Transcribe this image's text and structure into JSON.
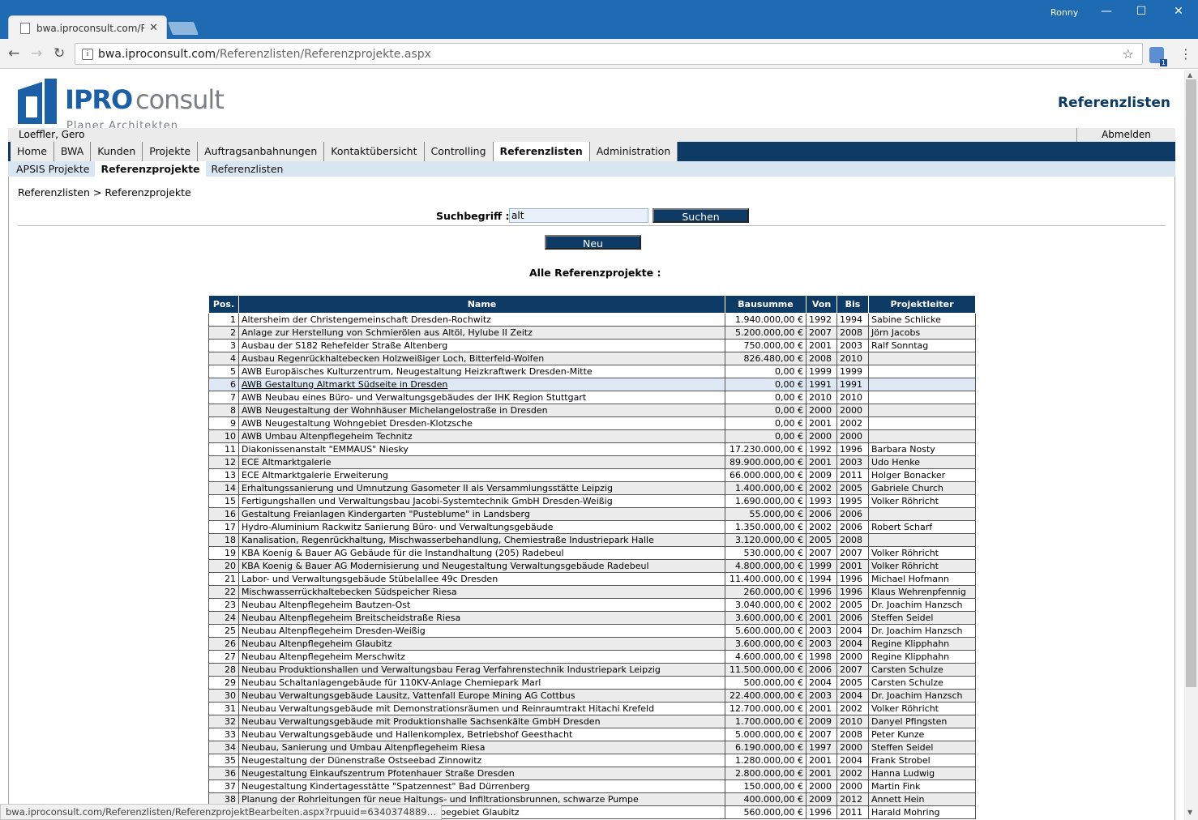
{
  "browser": {
    "tab_title": "bwa.iproconsult.com/Ref",
    "url_host": "bwa.iproconsult.com",
    "url_path": "/Referenzlisten/Referenzprojekte.aspx",
    "user": "Ronny",
    "extension_badge": "1",
    "status_url": "bwa.iproconsult.com/Referenzlisten/ReferenzprojektBearbeiten.aspx?rpuuid=6340374889…"
  },
  "header": {
    "logo_bold": "IPRO",
    "logo_light": "consult",
    "logo_tagline": "Planer  Architekten  Ingenieure",
    "page_title": "Referenzlisten",
    "username": "Loeffler, Gero",
    "logout": "Abmelden"
  },
  "mainnav": [
    "Home",
    "BWA",
    "Kunden",
    "Projekte",
    "Auftragsanbahnungen",
    "Kontaktübersicht",
    "Controlling",
    "Referenzlisten",
    "Administration"
  ],
  "mainnav_active": "Referenzlisten",
  "subnav": [
    "APSIS Projekte",
    "Referenzprojekte",
    "Referenzlisten"
  ],
  "subnav_active": "Referenzprojekte",
  "breadcrumb": "Referenzlisten > Referenzprojekte",
  "search": {
    "label": "Suchbegriff :",
    "value": "alt",
    "button": "Suchen"
  },
  "new_button": "Neu",
  "list_title": "Alle Referenzprojekte :",
  "table": {
    "headers": [
      "Pos.",
      "Name",
      "Bausumme",
      "Von",
      "Bis",
      "Projektleiter"
    ],
    "rows": [
      [
        "1",
        "Altersheim der Christengemeinschaft Dresden-Rochwitz",
        "1.940.000,00 €",
        "1992",
        "1994",
        "Sabine Schlicke"
      ],
      [
        "2",
        "Anlage zur Herstellung von Schmierölen aus Altöl, Hylube II Zeitz",
        "5.200.000,00 €",
        "2007",
        "2008",
        "Jörn Jacobs"
      ],
      [
        "3",
        "Ausbau der S182 Rehefelder Straße Altenberg",
        "750.000,00 €",
        "2001",
        "2003",
        "Ralf Sonntag"
      ],
      [
        "4",
        "Ausbau Regenrückhaltebecken Holzweißiger Loch, Bitterfeld-Wolfen",
        "826.480,00 €",
        "2008",
        "2010",
        ""
      ],
      [
        "5",
        "AWB Europäisches Kulturzentrum, Neugestaltung Heizkraftwerk Dresden-Mitte",
        "0,00 €",
        "1999",
        "1999",
        ""
      ],
      [
        "6",
        "AWB Gestaltung Altmarkt Südseite in Dresden",
        "0,00 €",
        "1991",
        "1991",
        ""
      ],
      [
        "7",
        "AWB Neubau eines Büro- und Verwaltungsgebäudes der IHK Region Stuttgart",
        "0,00 €",
        "2010",
        "2010",
        ""
      ],
      [
        "8",
        "AWB Neugestaltung der Wohnhäuser Michelangelostraße in Dresden",
        "0,00 €",
        "2000",
        "2000",
        ""
      ],
      [
        "9",
        "AWB Neugestaltung Wohngebiet Dresden-Klotzsche",
        "0,00 €",
        "2001",
        "2002",
        ""
      ],
      [
        "10",
        "AWB Umbau Altenpflegeheim Technitz",
        "0,00 €",
        "2000",
        "2000",
        ""
      ],
      [
        "11",
        "Diakonissenanstalt \"EMMAUS\" Niesky",
        "17.230.000,00 €",
        "1992",
        "1996",
        "Barbara Nosty"
      ],
      [
        "12",
        "ECE Altmarktgalerie",
        "89.900.000,00 €",
        "2001",
        "2003",
        "Udo Henke"
      ],
      [
        "13",
        "ECE Altmarktgalerie Erweiterung",
        "66.000.000,00 €",
        "2009",
        "2011",
        "Holger Bonacker"
      ],
      [
        "14",
        "Erhaltungssanierung und Umnutzung Gasometer II als Versammlungsstätte Leipzig",
        "1.400.000,00 €",
        "2002",
        "2005",
        "Gabriele Church"
      ],
      [
        "15",
        "Fertigungshallen und Verwaltungsbau Jacobi-Systemtechnik GmbH Dresden-Weißig",
        "1.690.000,00 €",
        "1993",
        "1995",
        "Volker Röhricht"
      ],
      [
        "16",
        "Gestaltung Freianlagen Kindergarten \"Pusteblume\" in Landsberg",
        "55.000,00 €",
        "2006",
        "2006",
        ""
      ],
      [
        "17",
        "Hydro-Aluminium Rackwitz Sanierung Büro- und Verwaltungsgebäude",
        "1.350.000,00 €",
        "2002",
        "2006",
        "Robert Scharf"
      ],
      [
        "18",
        "Kanalisation, Regenrückhaltung, Mischwasserbehandlung, Chemiestraße Industriepark Halle",
        "3.120.000,00 €",
        "2005",
        "2008",
        ""
      ],
      [
        "19",
        "KBA Koenig & Bauer AG Gebäude für die Instandhaltung (205) Radebeul",
        "530.000,00 €",
        "2007",
        "2007",
        "Volker Röhricht"
      ],
      [
        "20",
        "KBA Koenig & Bauer AG Modernisierung und Neugestaltung Verwaltungsgebäude Radebeul",
        "4.800.000,00 €",
        "1999",
        "2001",
        "Volker Röhricht"
      ],
      [
        "21",
        "Labor- und Verwaltungsgebäude Stübelallee 49c Dresden",
        "11.400.000,00 €",
        "1994",
        "1996",
        "Michael Hofmann"
      ],
      [
        "22",
        "Mischwasserrückhaltebecken Südspeicher Riesa",
        "260.000,00 €",
        "1996",
        "1996",
        "Klaus Wehrenpfennig"
      ],
      [
        "23",
        "Neubau Altenpflegeheim Bautzen-Ost",
        "3.040.000,00 €",
        "2002",
        "2005",
        "Dr. Joachim Hanzsch"
      ],
      [
        "24",
        "Neubau Altenpflegeheim Breitscheidstraße Riesa",
        "3.600.000,00 €",
        "2001",
        "2006",
        "Steffen Seidel"
      ],
      [
        "25",
        "Neubau Altenpflegeheim Dresden-Weißig",
        "5.600.000,00 €",
        "2003",
        "2004",
        "Dr. Joachim Hanzsch"
      ],
      [
        "26",
        "Neubau Altenpflegeheim Glaubitz",
        "3.600.000,00 €",
        "2003",
        "2004",
        "Regine Klipphahn"
      ],
      [
        "27",
        "Neubau Altenpflegeheim Merschwitz",
        "4.600.000,00 €",
        "1998",
        "2000",
        "Regine Klipphahn"
      ],
      [
        "28",
        "Neubau Produktionshallen und Verwaltungsbau Ferag Verfahrenstechnik Industriepark Leipzig",
        "11.500.000,00 €",
        "2006",
        "2007",
        "Carsten Schulze"
      ],
      [
        "29",
        "Neubau Schaltanlagengebäude für 110KV-Anlage Chemiepark Marl",
        "500.000,00 €",
        "2004",
        "2005",
        "Carsten Schulze"
      ],
      [
        "30",
        "Neubau Verwaltungsgebäude Lausitz, Vattenfall Europe Mining AG Cottbus",
        "22.400.000,00 €",
        "2003",
        "2004",
        "Dr. Joachim Hanzsch"
      ],
      [
        "31",
        "Neubau Verwaltungsgebäude mit Demonstrationsräumen und Reinraumtrakt Hitachi Krefeld",
        "12.700.000,00 €",
        "2001",
        "2002",
        "Volker Röhricht"
      ],
      [
        "32",
        "Neubau Verwaltungsgebäude mit Produktionshalle Sachsenkälte GmbH Dresden",
        "1.700.000,00 €",
        "2009",
        "2010",
        "Danyel Pfingsten"
      ],
      [
        "33",
        "Neubau Verwaltungsgebäude und Hallenkomplex, Betriebshof Geesthacht",
        "5.000.000,00 €",
        "2007",
        "2008",
        "Peter Kunze"
      ],
      [
        "34",
        "Neubau, Sanierung und Umbau Altenpflegeheim Riesa",
        "6.190.000,00 €",
        "1997",
        "2000",
        "Steffen Seidel"
      ],
      [
        "35",
        "Neugestaltung der Dünenstraße Ostseebad Zinnowitz",
        "1.280.000,00 €",
        "2001",
        "2004",
        "Frank Strobel"
      ],
      [
        "36",
        "Neugestaltung Einkaufszentrum Pfotenhauer Straße Dresden",
        "2.800.000,00 €",
        "2001",
        "2002",
        "Hanna Ludwig"
      ],
      [
        "37",
        "Neugestaltung Kindertagesstätte \"Spatzennest\" Bad Dürrenberg",
        "150.000,00 €",
        "2000",
        "2000",
        "Martin Fink"
      ],
      [
        "38",
        "Planung der Rohrleitungen für neue Haltungs- und Infiltrationsbrunnen, schwarze Pumpe",
        "400.000,00 €",
        "2009",
        "2012",
        "Annett Hein"
      ],
      [
        "39",
        "Planung Neubau Straße und Kanal im Gewerbegebiet Glaubitz",
        "560.000,00 €",
        "1996",
        "2011",
        "Harald Mohring"
      ]
    ]
  }
}
